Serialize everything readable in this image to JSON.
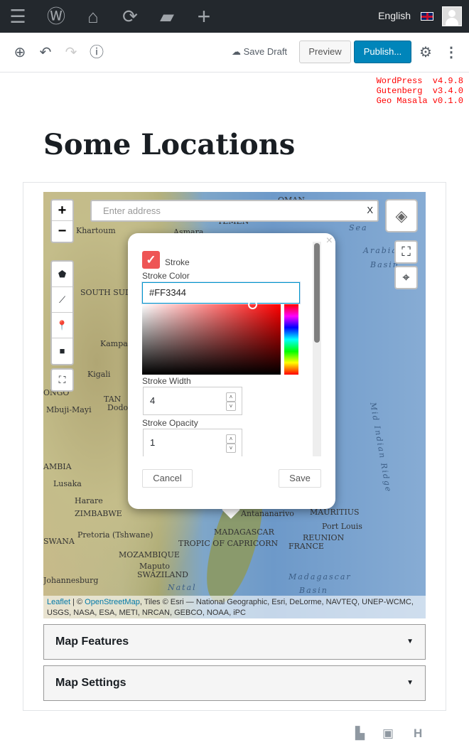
{
  "adminbar": {
    "language": "English",
    "icons": [
      "menu-icon",
      "wordpress-icon",
      "home-icon",
      "updates-icon",
      "comments-icon",
      "new-icon"
    ]
  },
  "toolbar": {
    "save_draft": "Save Draft",
    "preview": "Preview",
    "publish": "Publish..."
  },
  "versions": "WordPress  v4.9.8\nGutenberg  v3.4.0\nGeo Masala v0.1.0",
  "post_title": "Some Locations",
  "map": {
    "search_placeholder": "Enter address",
    "search_clear": "X",
    "labels": [
      {
        "t": "Khartoum"
      },
      {
        "t": "Asmara"
      },
      {
        "t": "YEMEN"
      },
      {
        "t": "OMAN"
      },
      {
        "t": "Sea"
      },
      {
        "t": "SOUTH SUDAN"
      },
      {
        "t": "Arabian"
      },
      {
        "t": "Basin"
      },
      {
        "t": "Kampala"
      },
      {
        "t": "Kigali"
      },
      {
        "t": "TAN"
      },
      {
        "t": "Dodo"
      },
      {
        "t": "ONGO"
      },
      {
        "t": "Mbuji-Mayi"
      },
      {
        "t": "AMBIA"
      },
      {
        "t": "Lusaka"
      },
      {
        "t": "Harare"
      },
      {
        "t": "ZIMBABWE"
      },
      {
        "t": "SWANA"
      },
      {
        "t": "Pretoria (Tshwane)"
      },
      {
        "t": "Maputo"
      },
      {
        "t": "MOZAMBIQUE"
      },
      {
        "t": "SWAZILAND"
      },
      {
        "t": "Johannesburg"
      },
      {
        "t": "Natal"
      },
      {
        "t": "Antananarivo"
      },
      {
        "t": "MADAGASCAR"
      },
      {
        "t": "TROPIC OF CAPRICORN"
      },
      {
        "t": "MAURITIUS"
      },
      {
        "t": "Port Louis"
      },
      {
        "t": "REUNION"
      },
      {
        "t": "FRANCE"
      },
      {
        "t": "Madagascar"
      },
      {
        "t": "Basin"
      },
      {
        "t": "Mid Indian Ridge"
      }
    ],
    "attribution": {
      "leaflet": "Leaflet",
      "sep": " | © ",
      "osm": "OpenStreetMap",
      "rest": ", Tiles © Esri — National Geographic, Esri, DeLorme, NAVTEQ, UNEP-WCMC, USGS, NASA, ESA, METI, NRCAN, GEBCO, NOAA, iPC"
    }
  },
  "popup": {
    "stroke_label": "Stroke",
    "stroke_checked": true,
    "stroke_color_label": "Stroke Color",
    "stroke_color": "#FF3344",
    "stroke_width_label": "Stroke Width",
    "stroke_width": "4",
    "stroke_opacity_label": "Stroke Opacity",
    "stroke_opacity": "1",
    "cancel": "Cancel",
    "save": "Save"
  },
  "panels": [
    {
      "title": "Map Features"
    },
    {
      "title": "Map Settings"
    }
  ],
  "colors": {
    "adminbar": "#23282d",
    "publish": "#0085ba",
    "version_text": "#ff0000",
    "checkbox": "#ee5555"
  }
}
